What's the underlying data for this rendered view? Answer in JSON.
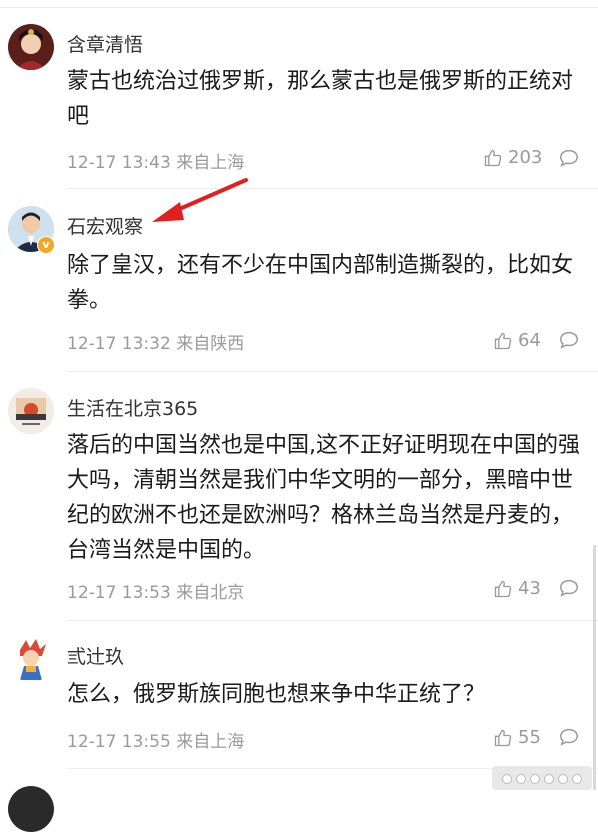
{
  "comments": [
    {
      "username": "含章清悟",
      "content": "蒙古也统治过俄罗斯，那么蒙古也是俄罗斯的正统对吧",
      "time_location": "12-17 13:43 来自上海",
      "likes": "203"
    },
    {
      "username": "石宏观察",
      "content": "除了皇汉，还有不少在中国内部制造撕裂的，比如女拳。",
      "time_location": "12-17 13:32 来自陕西",
      "likes": "64",
      "verified_badge": "v"
    },
    {
      "username": "生活在北京365",
      "content": "落后的中国当然也是中国,这不正好证明现在中国的强大吗，清朝当然是我们中华文明的一部分，黑暗中世纪的欧洲不也还是欧洲吗？格林兰岛当然是丹麦的，台湾当然是中国的。",
      "time_location": "12-17 13:53 来自北京",
      "likes": "43"
    },
    {
      "username": "弎辻玖",
      "content": "怎么，俄罗斯族同胞也想来争中华正统了？",
      "time_location": "12-17 13:55 来自上海",
      "likes": "55"
    }
  ],
  "colors": {
    "text": "#1a1a1a",
    "meta": "#9a9a9a",
    "arrow": "#e02020",
    "verified": "#f5a623"
  },
  "icons": [
    "thumbs-up-icon",
    "comment-bubble-icon",
    "annotation-arrow"
  ]
}
